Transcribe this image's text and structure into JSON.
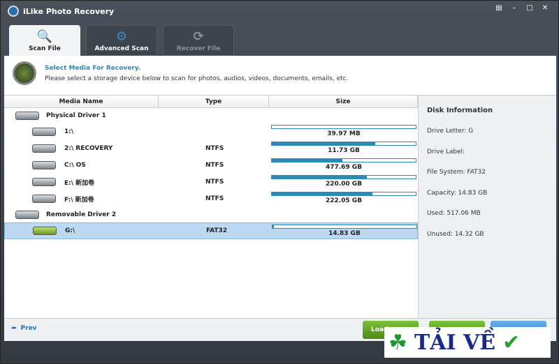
{
  "app": {
    "title": "iLike Photo Recovery"
  },
  "tabs": [
    {
      "label": "Scan File"
    },
    {
      "label": "Advanced Scan"
    },
    {
      "label": "Recover File"
    }
  ],
  "header": {
    "title": "Select Media For Recovery.",
    "subtitle": "Please select a storage device below to scan for photos, audios, videos, documents, emails, etc."
  },
  "table": {
    "columns": [
      "Media Name",
      "Type",
      "Size"
    ],
    "groups": [
      {
        "label": "Physical Driver 1",
        "rows": [
          {
            "name": "1:\\",
            "type": "",
            "size": "39.97 MB",
            "used_fraction": 0.0
          },
          {
            "name": "2:\\ RECOVERY",
            "type": "NTFS",
            "size": "11.73 GB",
            "used_fraction": 0.72
          },
          {
            "name": "C:\\ OS",
            "type": "NTFS",
            "size": "477.69 GB",
            "used_fraction": 0.49
          },
          {
            "name": "E:\\ 新加卷",
            "type": "NTFS",
            "size": "220.00 GB",
            "used_fraction": 0.66
          },
          {
            "name": "F:\\ 新加卷",
            "type": "NTFS",
            "size": "222.05 GB",
            "used_fraction": 0.7
          }
        ]
      },
      {
        "label": "Removable Driver 2",
        "rows": [
          {
            "name": "G:\\",
            "type": "FAT32",
            "size": "14.83 GB",
            "used_fraction": 0.01,
            "selected": true
          }
        ]
      }
    ]
  },
  "disk_info": {
    "title": "Disk Information",
    "lines": [
      "Drive Letter: G",
      "Drive Label:",
      "File System: FAT32",
      "Capacity: 14.83 GB",
      "Used: 517.06 MB",
      "Unused: 14.32 GB"
    ]
  },
  "footer": {
    "prev": "Prev",
    "load": "Load"
  },
  "watermark": {
    "text": "TẢI VỀ"
  },
  "colors": {
    "accent": "#2a8ab8",
    "green": "#5a9a1a",
    "blue": "#3a8ad0"
  }
}
